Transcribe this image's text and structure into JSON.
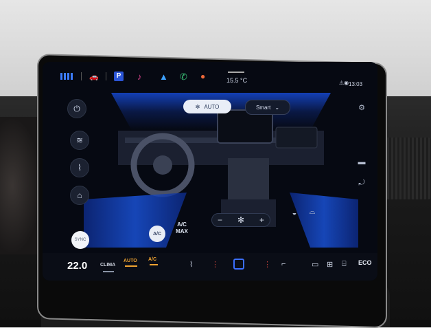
{
  "status_bar": {
    "outside_temp": "15.5 °C",
    "time": "13:03",
    "icons": [
      "apps-grid-icon",
      "car-icon",
      "parking-icon",
      "music-icon",
      "navigation-icon",
      "phone-icon",
      "profile-icon"
    ]
  },
  "climate_header": {
    "mode_label": "AUTO",
    "profile_label": "Smart"
  },
  "climate_controls": {
    "ac_label": "A/C",
    "ac_max_label": "A/C MAX",
    "sync_label": "SYNC",
    "fan_minus": "−",
    "fan_plus": "+"
  },
  "bottom_bar": {
    "driver_temp": "22.0",
    "clima_label": "CLIMA",
    "auto_label": "AUTO",
    "ac_label": "A/C",
    "eco_label": "ECO"
  },
  "colors": {
    "accent_blue": "#2d6bff",
    "accent_orange": "#f0a431",
    "screen_bg": "#060912"
  }
}
